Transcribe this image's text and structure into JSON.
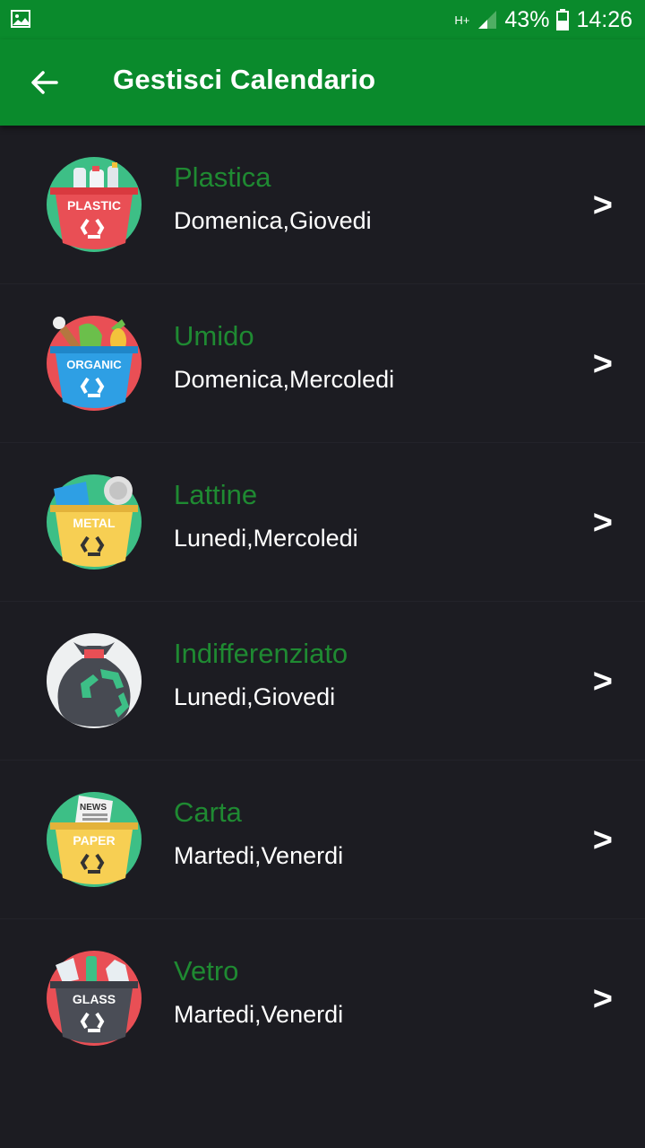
{
  "status": {
    "left_icon": "image-icon",
    "network": "H+",
    "battery_percent": "43%",
    "time": "14:26",
    "signal_level": 0.5,
    "battery_level": 0.43
  },
  "appbar": {
    "back_icon": "arrow-left-icon",
    "title": "Gestisci Calendario",
    "color": "#0a8a2c"
  },
  "categories": [
    {
      "name": "Plastica",
      "days": "Domenica,Giovedi",
      "badge": "PLASTIC",
      "icon": "plastic-bin-icon",
      "chevron": ">"
    },
    {
      "name": "Umido",
      "days": "Domenica,Mercoledi",
      "badge": "ORGANIC",
      "icon": "organic-bin-icon",
      "chevron": ">"
    },
    {
      "name": "Lattine",
      "days": "Lunedi,Mercoledi",
      "badge": "METAL",
      "icon": "metal-bin-icon",
      "chevron": ">"
    },
    {
      "name": "Indifferenziato",
      "days": "Lunedi,Giovedi",
      "icon": "garbage-bag-icon",
      "chevron": ">"
    },
    {
      "name": "Carta",
      "days": "Martedi,Venerdi",
      "badge": "PAPER",
      "news_label": "NEWS",
      "icon": "paper-bin-icon",
      "chevron": ">"
    },
    {
      "name": "Vetro",
      "days": "Martedi,Venerdi",
      "badge": "GLASS",
      "icon": "glass-bin-icon",
      "chevron": ">"
    }
  ],
  "colors": {
    "category_name": "#1f8a32",
    "background": "#1c1c22"
  }
}
